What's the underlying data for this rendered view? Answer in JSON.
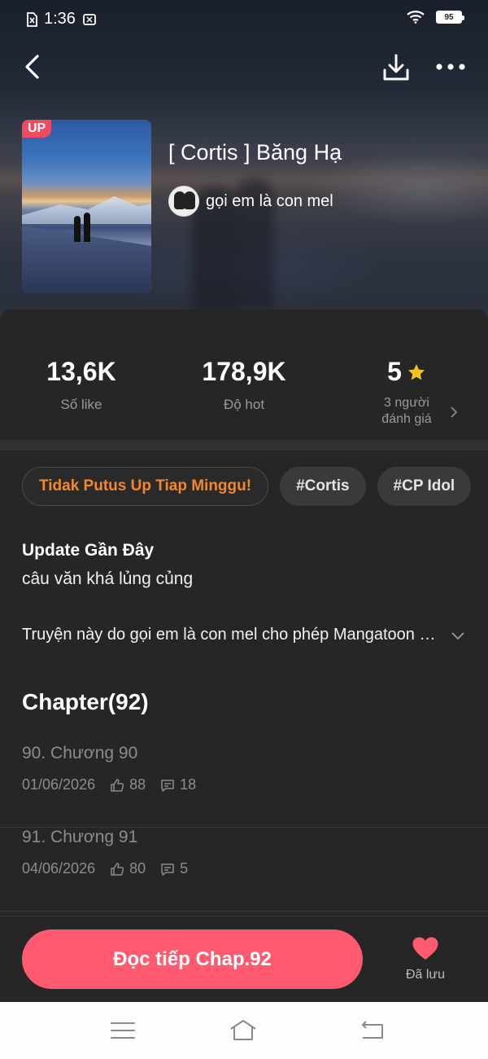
{
  "status_bar": {
    "time": "1:36",
    "battery": "95"
  },
  "book": {
    "title": "[ Cortis ] Băng Hạ",
    "author": "gọi em là con mel",
    "badge": "UP"
  },
  "stats": [
    {
      "value": "13,6K",
      "label": "Số like"
    },
    {
      "value": "178,9K",
      "label": "Độ hot"
    },
    {
      "value": "5",
      "label": "3 người\nđánh giá"
    }
  ],
  "tags": [
    "Tidak Putus Up Tiap Minggu!",
    "#Cortis",
    "#CP Idol"
  ],
  "recent_update": {
    "heading": "Update Gần Đây",
    "text": "câu văn khá lủng củng"
  },
  "description": "Truyện này do gọi em là con mel cho phép Mangatoon đăng tải",
  "chapters": {
    "heading": "Chapter(92)",
    "items": [
      {
        "title": "90. Chương 90",
        "date": "01/06/2026",
        "likes": "88",
        "comments": "18"
      },
      {
        "title": "91. Chương 91",
        "date": "04/06/2026",
        "likes": "80",
        "comments": "5"
      }
    ]
  },
  "actions": {
    "read_button": "Đọc tiếp Chap.92",
    "saved_label": "Đã lưu"
  },
  "colors": {
    "accent": "#ff5a70",
    "promo_tag": "#f0882f",
    "star": "#f6c21c"
  }
}
